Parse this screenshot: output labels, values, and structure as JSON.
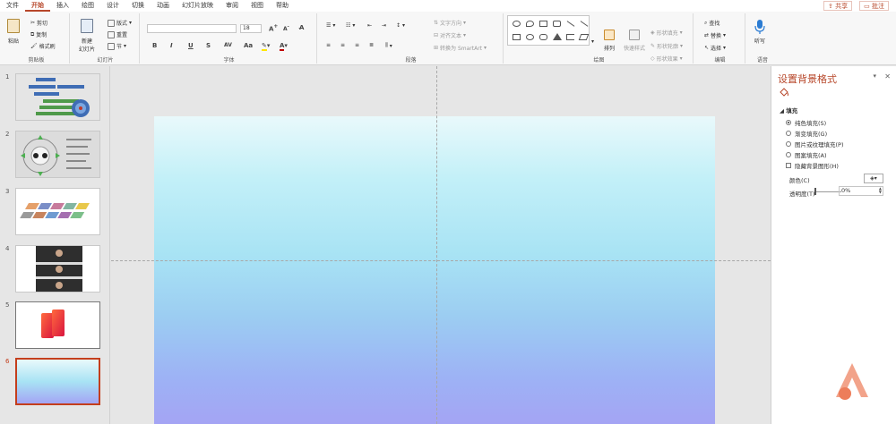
{
  "menu": {
    "items": [
      "文件",
      "开始",
      "插入",
      "绘图",
      "设计",
      "切换",
      "动画",
      "幻灯片放映",
      "审阅",
      "视图",
      "帮助"
    ],
    "active": "开始",
    "share": "共享",
    "comment": "批注"
  },
  "ribbon": {
    "clipboard": {
      "label": "剪贴板",
      "paste": "粘贴",
      "cut": "剪切",
      "copy": "复制",
      "format_painter": "格式刷"
    },
    "slides": {
      "label": "幻灯片",
      "new_slide": "新建\n幻灯片",
      "layout": "版式",
      "reset": "重置",
      "section": "节"
    },
    "font": {
      "label": "字体",
      "font_size": "18",
      "bold": "B",
      "italic": "I",
      "underline": "U",
      "strike": "S",
      "spacing": "AV",
      "case": "Aa",
      "grow": "A",
      "shrink": "A"
    },
    "paragraph": {
      "label": "段落",
      "text_direction": "文字方向",
      "align_text": "对齐文本",
      "smartart": "转换为 SmartArt"
    },
    "drawing": {
      "label": "绘图",
      "arrange": "排列",
      "quick_styles": "快速样式",
      "shape_fill": "形状填充",
      "shape_outline": "形状轮廓",
      "shape_effects": "形状效果"
    },
    "editing": {
      "label": "编辑",
      "find": "查找",
      "replace": "替换",
      "select": "选择"
    },
    "voice": {
      "label": "语音",
      "dictate": "听写"
    }
  },
  "thumbnails": [
    {
      "num": "1"
    },
    {
      "num": "2"
    },
    {
      "num": "3"
    },
    {
      "num": "4"
    },
    {
      "num": "5"
    },
    {
      "num": "6",
      "selected": true
    }
  ],
  "pane": {
    "title": "设置背景格式",
    "section": "填充",
    "options": [
      {
        "label": "纯色填充(S)",
        "checked": true,
        "type": "radio"
      },
      {
        "label": "渐变填充(G)",
        "checked": false,
        "type": "radio"
      },
      {
        "label": "图片或纹理填充(P)",
        "checked": false,
        "type": "radio"
      },
      {
        "label": "图案填充(A)",
        "checked": false,
        "type": "radio"
      },
      {
        "label": "隐藏背景图形(H)",
        "checked": false,
        "type": "checkbox"
      }
    ],
    "color_label": "颜色(C)",
    "transparency_label": "透明度(T)",
    "transparency_value": "0%",
    "transparency": 0
  },
  "colors": {
    "accent": "#b7472a",
    "slide_top": "#e9f9fb",
    "slide_bottom": "#a4a4f4"
  }
}
